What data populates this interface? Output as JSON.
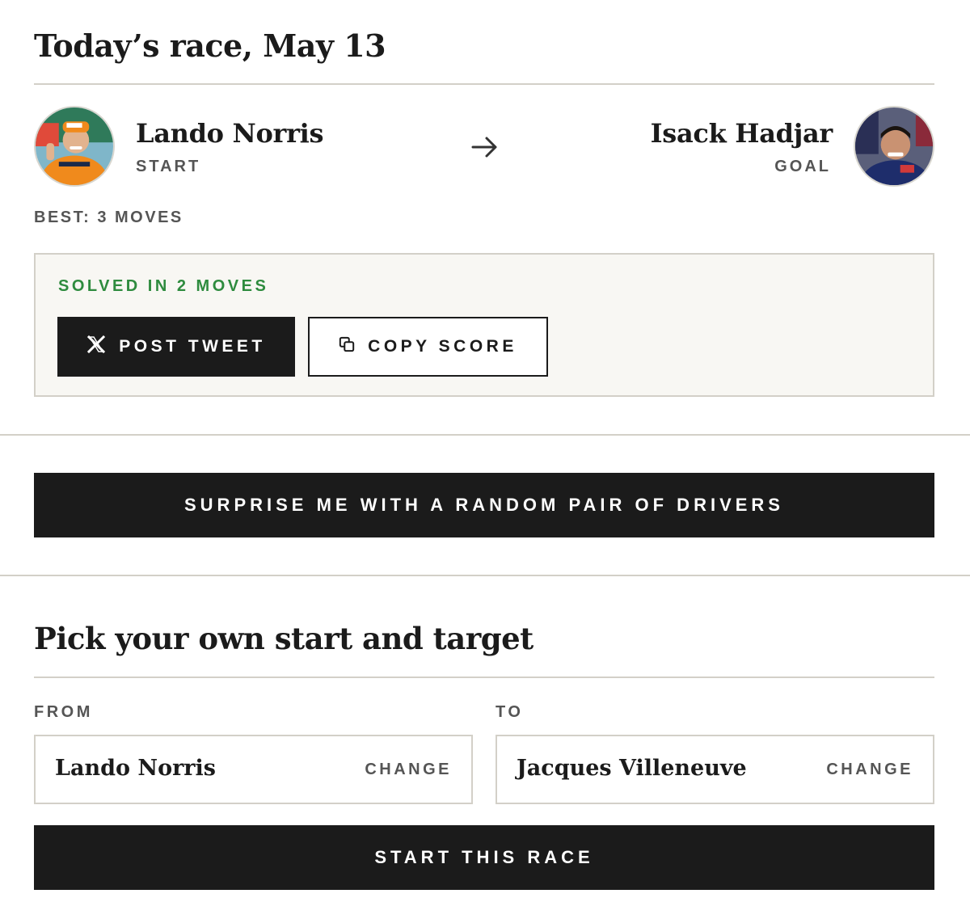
{
  "today": {
    "title": "Today’s race, May 13",
    "start": {
      "name": "Lando Norris",
      "role": "START"
    },
    "goal": {
      "name": "Isack Hadjar",
      "role": "GOAL"
    },
    "best": "BEST: 3 MOVES",
    "result": {
      "status": "SOLVED IN 2 MOVES",
      "post_label": "POST TWEET",
      "copy_label": "COPY SCORE"
    }
  },
  "random_button_label": "SURPRISE ME WITH A RANDOM PAIR OF DRIVERS",
  "custom": {
    "title": "Pick your own start and target",
    "from": {
      "label": "FROM",
      "value": "Lando Norris",
      "change_label": "CHANGE"
    },
    "to": {
      "label": "TO",
      "value": "Jacques Villeneuve",
      "change_label": "CHANGE"
    },
    "start_label": "START THIS RACE"
  },
  "colors": {
    "accent_dark": "#1b1b1b",
    "success": "#2e8b3e",
    "panel_bg": "#f8f7f3",
    "divider": "#d3d0c8"
  },
  "icons": {
    "arrow": "arrow-right-icon",
    "post": "x-logo-icon",
    "copy": "copy-icon"
  }
}
